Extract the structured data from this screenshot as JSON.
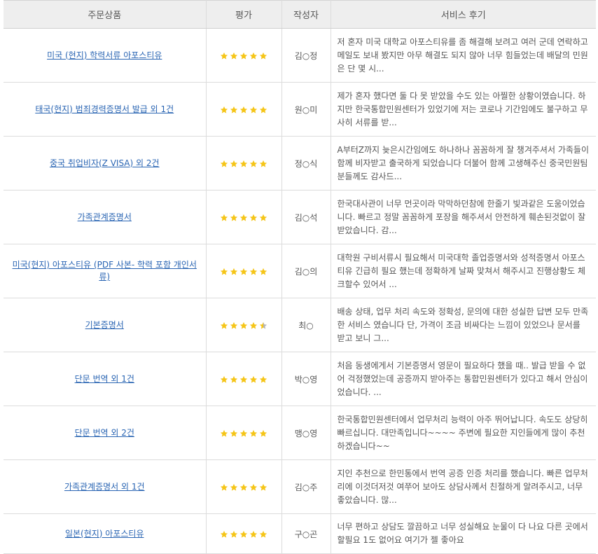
{
  "colors": {
    "star_full": "#f5c518",
    "star_empty": "#b5b5b5",
    "link": "#2a65b3",
    "header_bg": "#eeeeee"
  },
  "table": {
    "headers": {
      "product": "주문상품",
      "rating": "평가",
      "author": "작성자",
      "review": "서비스 후기"
    },
    "rows": [
      {
        "product": "미국 (현지) 학력서류 아포스티유",
        "rating": 5,
        "author": "김○정",
        "review": "저 혼자 미국 대학교 아포스티유를 좀 해결해 보려고 여러 군데 연락하고 메일도 보내 봤지만 아무 해결도 되지 않아 너무 힘들었는데 배달의 민원은 단 몇 시..."
      },
      {
        "product": "태국(현지) 범죄경력증명서 발급 외 1건",
        "rating": 5,
        "author": "원○미",
        "review": "제가 혼자 했다면 둘 다 못 받았을 수도 있는 아찔한 상황이였습니다. 하지만 한국통합민원센터가 있었기에 저는 코로나 기간임에도 불구하고 무사히 서류를 받..."
      },
      {
        "product": "중국 취업비자(Z VISA) 외 2건",
        "rating": 5,
        "author": "정○식",
        "review": "A부터Z까지 늦은시간임에도 하나하나 꼼꼼하게 잘 챙겨주셔서 가족들이 함께 비자받고 출국하게 되었습니다 더불어 함께 고생해주신 중국민원팀분들께도 감사드..."
      },
      {
        "product": "가족관계증명서",
        "rating": 5,
        "author": "김○석",
        "review": "한국대사관이 너무 먼곳이라 막막하던참에 한줄기 빛과같은 도움이었습니다. 빠르고 정말 꼼꼼하게 포장을 해주셔서 안전하게 훼손된것없이 잘 받았습니다. 감..."
      },
      {
        "product": "미국(현지) 아포스티유 (PDF 사본- 학력 포함 개인서류)",
        "rating": 5,
        "author": "김○의",
        "review": "대학원 구비서류시 필요해서 미국대학 졸업증명서와 성적증명서 아포스티유 긴급히 필요 했는데 정확하게 날짜 맞쳐서 해주시고 진행상황도 체크할수 있어서 ..."
      },
      {
        "product": "기본증명서",
        "rating": 4.5,
        "author": "최○",
        "review": "배송 상태, 업무 처리 속도와 정확성, 문의에 대한 성실한 답변 모두 만족한 서비스 였습니다 단, 가격이 조금 비싸다는 느낌이 있었으나 문서를 받고 보니 그..."
      },
      {
        "product": "단문 번역 외 1건",
        "rating": 5,
        "author": "박○영",
        "review": "처음 동생에게서 기본증명서 영문이 필요하다 했을 때.. 발급 받을 수 없어 걱정했었는데 공증까지 받아주는 통합민원센터가 있다고 해서 안심이었습니다. ..."
      },
      {
        "product": "단문 번역 외 2건",
        "rating": 5,
        "author": "맹○영",
        "review": "한국통합민원센터에서 업무처리 능력이 아주 뛰어납니다. 속도도 상당히 빠르십니다. 대만족입니다~~~~ 주변에 필요한 지인들에게 많이 추천하겠습니다~~"
      },
      {
        "product": "가족관계증명서 외 1건",
        "rating": 5,
        "author": "김○주",
        "review": "지인 추천으로 한민통에서 번역 공증 인증 처리를 했습니다. 빠른 업무처리에 이것더저것 여쭈어 보아도 상담사께서 친절하게 알려주시고, 너무 좋았습니다. 많..."
      },
      {
        "product": "일본(현지) 아포스티유",
        "rating": 5,
        "author": "구○곤",
        "review": "너무 편하고 상담도 깔끔하고 너무 성실해요 눈물이 다 나요 다른 곳에서 할필요 1도 없어요 여기가 젤 좋아요"
      }
    ]
  }
}
